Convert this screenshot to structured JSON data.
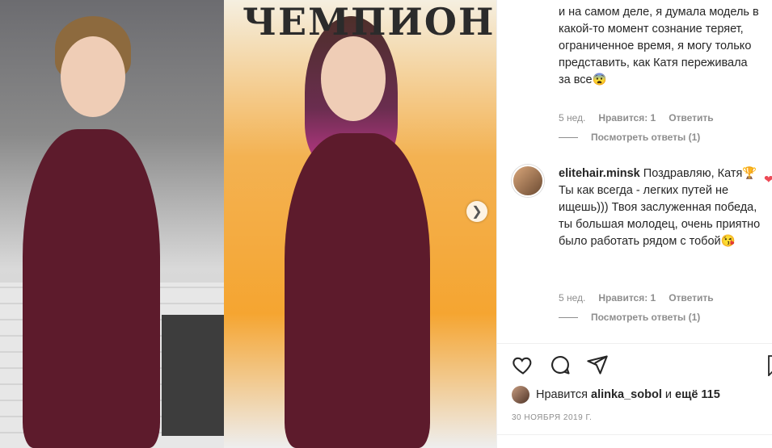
{
  "post": {
    "banner_text": "ЧЕМПИОН",
    "next_button_icon": "chevron-right-icon"
  },
  "comments": [
    {
      "text": "и на самом деле, я думала модель в какой-то момент сознание теряет, ограниченное время, я могу только представить, как Катя переживала за все😨",
      "time": "5 нед.",
      "likes_label": "Нравится: 1",
      "reply_label": "Ответить",
      "view_replies": "Посмотреть ответы (1)"
    },
    {
      "username": "elitehair.minsk",
      "text": "Поздравляю, Катя🏆 Ты как всегда - легких путей не ищешь))) Твоя заслуженная победа, ты большая молодец, очень приятно было работать рядом с тобой😘",
      "time": "5 нед.",
      "likes_label": "Нравится: 1",
      "reply_label": "Ответить",
      "view_replies": "Посмотреть ответы (1)"
    }
  ],
  "likes": {
    "prefix": "Нравится",
    "user": "alinka_sobol",
    "conj": "и",
    "more": "ещё 115"
  },
  "date": "30 НОЯБРЯ 2019 Г.",
  "colors": {
    "like_heart": "#ed4956",
    "muted": "#8e8e8e"
  }
}
